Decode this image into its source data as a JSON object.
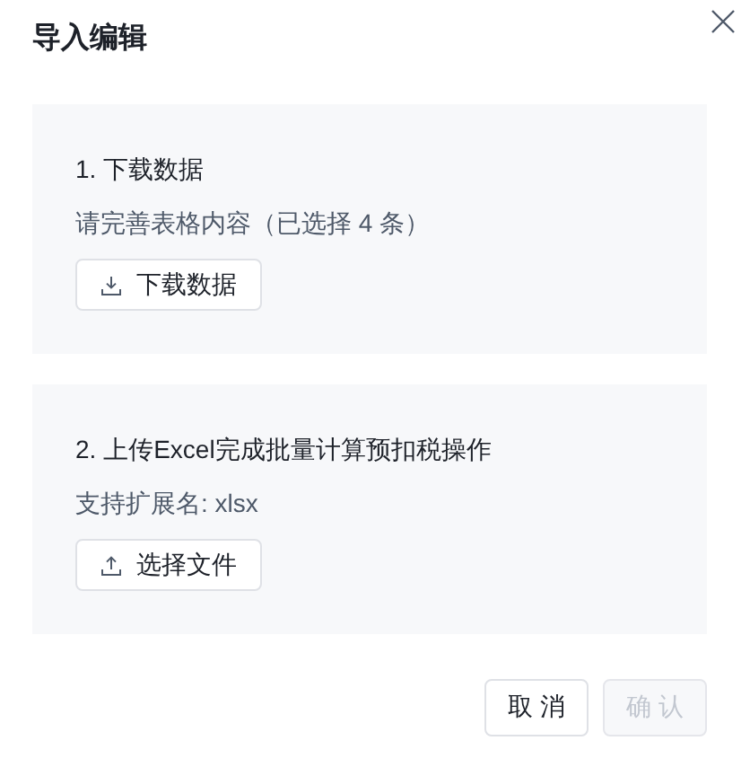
{
  "dialog": {
    "title": "导入编辑"
  },
  "steps": [
    {
      "title": "1. 下载数据",
      "hint": "请完善表格内容（已选择 4 条）",
      "action": {
        "kind": "download",
        "label": "下载数据"
      }
    },
    {
      "title": "2. 上传Excel完成批量计算预扣税操作",
      "hint": "支持扩展名: xlsx",
      "action": {
        "kind": "upload",
        "label": "选择文件"
      }
    }
  ],
  "footer_buttons": [
    {
      "label": "取 消",
      "disabled": false
    },
    {
      "label": "确 认",
      "disabled": true
    }
  ]
}
